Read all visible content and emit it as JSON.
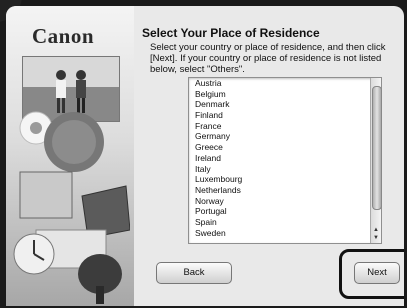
{
  "branding": {
    "logo_text": "Canon"
  },
  "header": {
    "title": "Select Your Place of Residence",
    "description": "Select your country or place of residence, and then click [Next]. If your country or place of residence is not listed below, select \"Others\"."
  },
  "country_list": {
    "items": [
      "Austria",
      "Belgium",
      "Denmark",
      "Finland",
      "France",
      "Germany",
      "Greece",
      "Ireland",
      "Italy",
      "Luxembourg",
      "Netherlands",
      "Norway",
      "Portugal",
      "Spain",
      "Sweden"
    ]
  },
  "buttons": {
    "back_label": "Back",
    "next_label": "Next"
  }
}
